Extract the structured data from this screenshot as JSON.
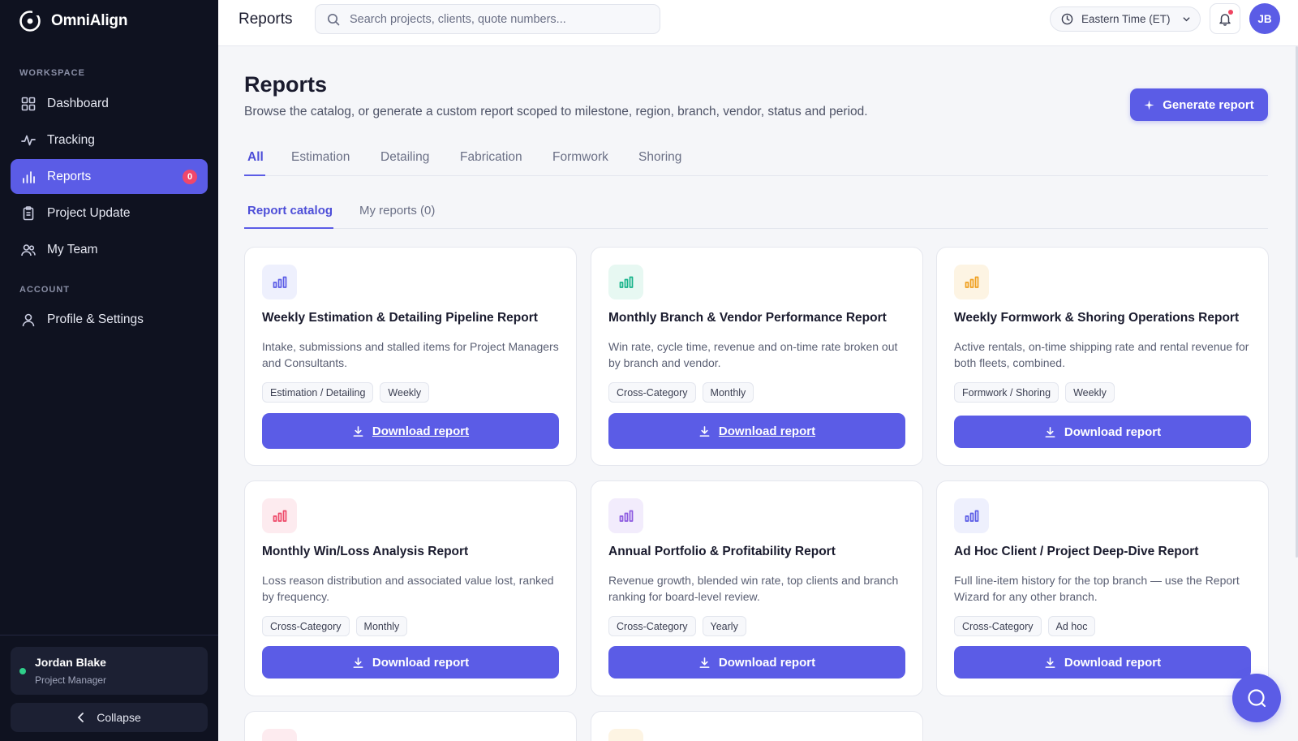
{
  "app": {
    "name": "OmniAlign"
  },
  "sidebar": {
    "workspace_label": "WORKSPACE",
    "account_label": "ACCOUNT",
    "items": [
      {
        "label": "Dashboard",
        "icon": "grid-icon"
      },
      {
        "label": "Tracking",
        "icon": "activity-icon"
      },
      {
        "label": "Reports",
        "icon": "bar-chart-icon",
        "badge": "0",
        "active": true
      },
      {
        "label": "Project Update",
        "icon": "clipboard-icon"
      },
      {
        "label": "My Team",
        "icon": "users-icon"
      },
      {
        "label": "Profile & Settings",
        "icon": "user-icon"
      }
    ],
    "user": {
      "name": "Jordan Blake",
      "role": "Project Manager"
    },
    "collapse_label": "Collapse"
  },
  "topbar": {
    "title": "Reports",
    "search_placeholder": "Search projects, clients, quote numbers...",
    "timezone": "Eastern Time (ET)",
    "avatar_initials": "JB"
  },
  "page": {
    "title": "Reports",
    "subtitle": "Browse the catalog, or generate a custom report scoped to milestone, region, branch, vendor, status and period.",
    "generate_label": "Generate report",
    "tabs": [
      "All",
      "Estimation",
      "Detailing",
      "Fabrication",
      "Formwork",
      "Shoring"
    ],
    "subtabs": [
      "Report catalog",
      "My reports (0)"
    ]
  },
  "colors": {
    "accent": "#5b5ce6",
    "sidebar_bg": "#0f1220",
    "badge": "#f0476b"
  },
  "cards": [
    {
      "title": "Weekly Estimation & Detailing Pipeline Report",
      "desc": "Intake, submissions and stalled items for Project Managers and Consultants.",
      "tags": [
        "Estimation / Detailing",
        "Weekly"
      ],
      "button": "Download report",
      "icon_color": "#5b5ce6",
      "icon_bg": "#eef0fd"
    },
    {
      "title": "Monthly Branch & Vendor Performance Report",
      "desc": "Win rate, cycle time, revenue and on-time rate broken out by branch and vendor.",
      "tags": [
        "Cross-Category",
        "Monthly"
      ],
      "button": "Download report",
      "icon_color": "#17b38a",
      "icon_bg": "#e7f8f2"
    },
    {
      "title": "Weekly Formwork & Shoring Operations Report",
      "desc": "Active rentals, on-time shipping rate and rental revenue for both fleets, combined.",
      "tags": [
        "Formwork / Shoring",
        "Weekly"
      ],
      "button": "Download report",
      "icon_color": "#f0a020",
      "icon_bg": "#fdf4e3"
    },
    {
      "title": "Monthly Win/Loss Analysis Report",
      "desc": "Loss reason distribution and associated value lost, ranked by frequency.",
      "tags": [
        "Cross-Category",
        "Monthly"
      ],
      "button": "Download report",
      "icon_color": "#ee4a6a",
      "icon_bg": "#fdebef"
    },
    {
      "title": "Annual Portfolio & Profitability Report",
      "desc": "Revenue growth, blended win rate, top clients and branch ranking for board-level review.",
      "tags": [
        "Cross-Category",
        "Yearly"
      ],
      "button": "Download report",
      "icon_color": "#8e5be0",
      "icon_bg": "#f2ecfc"
    },
    {
      "title": "Ad Hoc Client / Project Deep-Dive Report",
      "desc": "Full line-item history for the top branch — use the Report Wizard for any other branch.",
      "tags": [
        "Cross-Category",
        "Ad hoc"
      ],
      "button": "Download report",
      "icon_color": "#5b5ce6",
      "icon_bg": "#eef0fd"
    }
  ]
}
